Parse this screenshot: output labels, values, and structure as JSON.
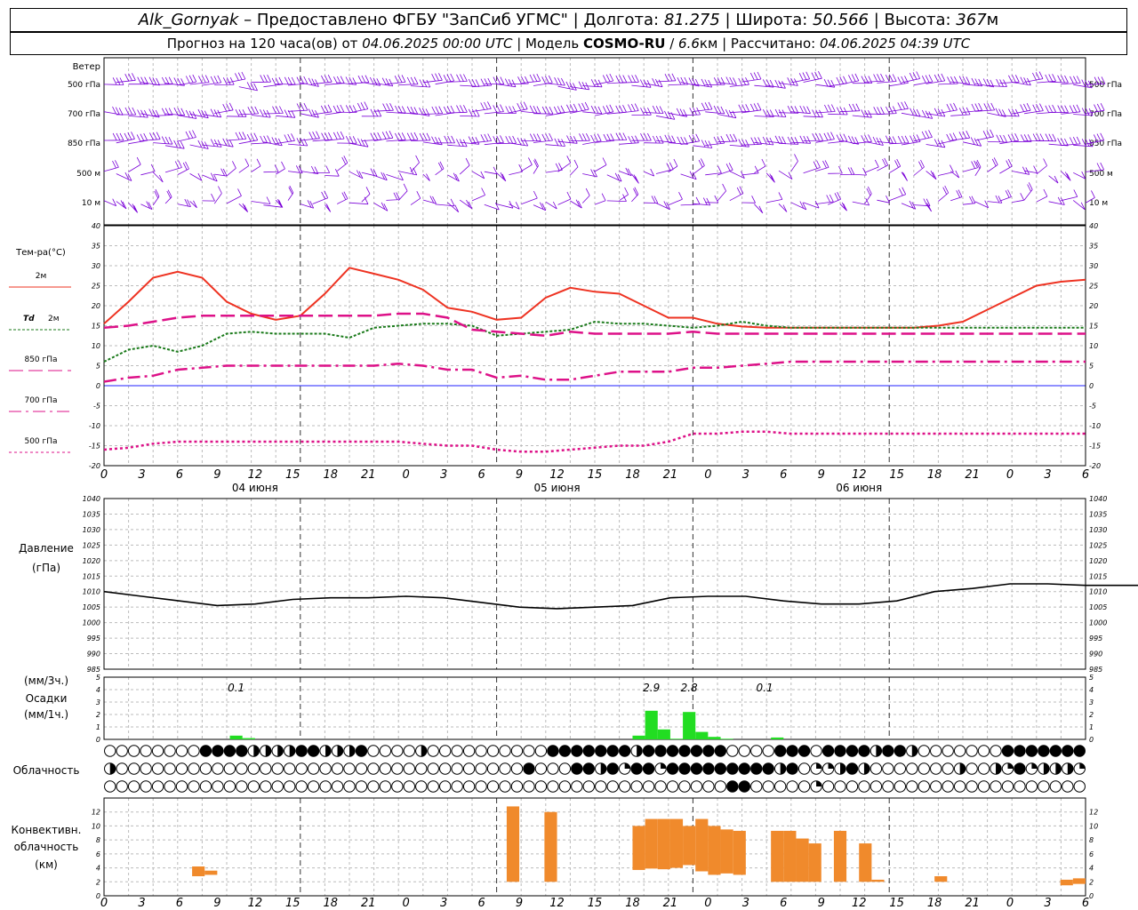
{
  "header": {
    "station": "Alk_Gornyak",
    "dash": " – ",
    "provider": "Предоставлено ФГБУ \"ЗапСиб УГМС\"",
    "sep": " | ",
    "lon_label": "Долгота: ",
    "lon": "81.275",
    "lat_label": "Широта: ",
    "lat": "50.566",
    "alt_label": "Высота: ",
    "alt": "367",
    "alt_unit": "м"
  },
  "subheader": {
    "forecast": "Прогноз на 120 часа(ов) от ",
    "start": "04.06.2025 00:00 UTC",
    "model_label": " | Модель ",
    "model": "COSMO-RU",
    "slash": " / ",
    "res": "6.6",
    "res_unit": "км",
    "calc_label": " | Рассчитано: ",
    "calc": "04.06.2025 04:39 UTC"
  },
  "colors": {
    "wind": "#7a00d8",
    "t2m": "#ee3322",
    "td": "#1a7a1a",
    "t850": "#dd1188",
    "t700": "#dd1188",
    "t500": "#dd1188",
    "zero_line": "#2222ff",
    "pressure": "#000000",
    "precip": "#22dd22",
    "convective": "#f08a2c",
    "grid": "#bbbbbb"
  },
  "wind_panel": {
    "title": "Ветер",
    "levels": [
      "500 гПа",
      "700 гПа",
      "850 гПа",
      "500 м",
      "10 м"
    ]
  },
  "x_axis": {
    "hours": [
      "0",
      "3",
      "6",
      "9",
      "12",
      "15",
      "18",
      "21",
      "0",
      "3",
      "6",
      "9",
      "12",
      "15",
      "18",
      "21",
      "0",
      "3",
      "6",
      "9",
      "12",
      "15",
      "18",
      "21",
      "0",
      "3",
      "6"
    ],
    "days": [
      "04 июня",
      "05 июня",
      "06 июня"
    ]
  },
  "chart_data": [
    {
      "type": "line",
      "title": "Тем-ра(°С)",
      "x_hours": [
        0,
        3,
        6,
        9,
        12,
        15,
        18,
        21,
        24,
        27,
        30,
        33,
        36,
        39,
        42,
        45,
        48,
        51,
        54,
        57,
        60,
        63,
        66,
        69,
        72,
        75,
        78,
        81,
        84,
        87,
        90,
        93,
        96,
        99,
        102,
        105,
        108,
        111,
        114,
        117,
        120
      ],
      "ylim": [
        -20,
        40
      ],
      "yticks": [
        -20,
        -15,
        -10,
        -5,
        0,
        5,
        10,
        15,
        20,
        25,
        30,
        35,
        40
      ],
      "series": [
        {
          "name": "2м",
          "values": [
            15.5,
            21,
            27,
            28.5,
            27,
            21,
            18,
            16.5,
            17.5,
            23,
            29.5,
            28,
            26.5,
            24,
            19.5,
            18.5,
            16.5,
            17,
            22,
            24.5,
            23.5,
            23,
            20,
            17,
            17,
            15.5,
            14.8,
            14.5,
            14.5,
            14.5,
            14.5,
            14.5,
            14.5,
            14.5,
            15,
            16,
            19,
            22,
            25,
            26,
            26.5
          ]
        },
        {
          "name": "Td 2м",
          "values": [
            6,
            9,
            10,
            8.5,
            10,
            13,
            13.5,
            13,
            13,
            13,
            12,
            14.5,
            15,
            15.5,
            15.5,
            15,
            12.5,
            13,
            13.5,
            14,
            16,
            15.5,
            15.5,
            15,
            14.5,
            15,
            16,
            15,
            14.5,
            14.5,
            14.5,
            14.5,
            14.5,
            14.5,
            14.5,
            14.5,
            14.5,
            14.5,
            14.5,
            14.5,
            14.5
          ]
        },
        {
          "name": "850 гПа",
          "values": [
            14.5,
            15,
            16,
            17,
            17.5,
            17.5,
            17.5,
            17.5,
            17.5,
            17.5,
            17.5,
            17.5,
            18,
            18,
            17,
            14,
            13.5,
            13,
            12.5,
            13.5,
            13,
            13,
            13,
            13,
            13.5,
            13,
            13,
            13,
            13,
            13,
            13,
            13,
            13,
            13,
            13,
            13,
            13,
            13,
            13,
            13,
            13
          ]
        },
        {
          "name": "700 гПа",
          "values": [
            1,
            2,
            2.5,
            4,
            4.5,
            5,
            5,
            5,
            5,
            5,
            5,
            5,
            5.5,
            5,
            4,
            4,
            2,
            2.5,
            1.5,
            1.5,
            2.5,
            3.5,
            3.5,
            3.5,
            4.5,
            4.5,
            5,
            5.5,
            6,
            6,
            6,
            6,
            6,
            6,
            6,
            6,
            6,
            6,
            6,
            6,
            6
          ]
        },
        {
          "name": "500 гПа",
          "values": [
            -16,
            -15.5,
            -14.5,
            -14,
            -14,
            -14,
            -14,
            -14,
            -14,
            -14,
            -14,
            -14,
            -14,
            -14.5,
            -15,
            -15,
            -16,
            -16.5,
            -16.5,
            -16,
            -15.5,
            -15,
            -15,
            -14,
            -12,
            -12,
            -11.5,
            -11.5,
            -12,
            -12,
            -12,
            -12,
            -12,
            -12,
            -12,
            -12,
            -12,
            -12,
            -12,
            -12,
            -12
          ]
        }
      ]
    },
    {
      "type": "line",
      "title": "Давление",
      "ylabel": "(гПа)",
      "ylim": [
        985,
        1040
      ],
      "yticks": [
        985,
        990,
        995,
        1000,
        1005,
        1010,
        1015,
        1020,
        1025,
        1030,
        1035,
        1040
      ],
      "x_hours": [
        0,
        3,
        6,
        9,
        12,
        15,
        18,
        21,
        24,
        27,
        30,
        33,
        36,
        39,
        42,
        45,
        48,
        51,
        54,
        57,
        60,
        63,
        66,
        69,
        72,
        75,
        78,
        81,
        84,
        87,
        90,
        93,
        96,
        99,
        102,
        105,
        108,
        111,
        114,
        117,
        120
      ],
      "values": [
        1010,
        1008.5,
        1007,
        1005.5,
        1006,
        1007.5,
        1008,
        1008,
        1008.5,
        1008,
        1006.5,
        1005,
        1004.5,
        1005,
        1005.5,
        1008,
        1008.5,
        1008.5,
        1007,
        1006,
        1006,
        1007,
        1010,
        1011,
        1012.5,
        1012.5,
        1012,
        1012,
        1012,
        1012,
        1012,
        1012,
        1012,
        1012,
        1012,
        1012,
        1012,
        1012,
        1012,
        1012,
        1012
      ]
    },
    {
      "type": "bar",
      "title": "Осадки",
      "ylabel_3h": "(мм/3ч.)",
      "ylabel_1h": "(мм/1ч.)",
      "ylim": [
        0,
        5
      ],
      "yticks": [
        0,
        1,
        2,
        3,
        4,
        5
      ],
      "x_hours": [
        10,
        11,
        42,
        43,
        44,
        45,
        46,
        47,
        48,
        49,
        53
      ],
      "values": [
        0.3,
        0.1,
        0.3,
        2.3,
        0.8,
        0.05,
        2.2,
        0.6,
        0.2,
        0.05,
        0.15
      ],
      "labels": [
        {
          "hour": 10.5,
          "text": "0.1"
        },
        {
          "hour": 43.5,
          "text": "2.9"
        },
        {
          "hour": 46.5,
          "text": "2.8"
        },
        {
          "hour": 52.5,
          "text": "0.1"
        }
      ]
    },
    {
      "type": "bar",
      "title": "Конвективн. облачность",
      "ylabel": "(км)",
      "ylim": [
        0,
        13
      ],
      "yticks": [
        0,
        2,
        4,
        6,
        8,
        10,
        12
      ],
      "bars": [
        {
          "hour": 7,
          "bottom": 2.8,
          "top": 4.2
        },
        {
          "hour": 8,
          "bottom": 3.0,
          "top": 3.6
        },
        {
          "hour": 32,
          "bottom": 2.0,
          "top": 12.8
        },
        {
          "hour": 35,
          "bottom": 2.0,
          "top": 12.0
        },
        {
          "hour": 42,
          "bottom": 3.7,
          "top": 10.0
        },
        {
          "hour": 43,
          "bottom": 3.9,
          "top": 11.0
        },
        {
          "hour": 44,
          "bottom": 3.8,
          "top": 11.0
        },
        {
          "hour": 45,
          "bottom": 4.0,
          "top": 11.0
        },
        {
          "hour": 46,
          "bottom": 4.4,
          "top": 10.0
        },
        {
          "hour": 47,
          "bottom": 3.5,
          "top": 11.0
        },
        {
          "hour": 48,
          "bottom": 3.0,
          "top": 10.0
        },
        {
          "hour": 49,
          "bottom": 3.2,
          "top": 9.5
        },
        {
          "hour": 50,
          "bottom": 3.0,
          "top": 9.3
        },
        {
          "hour": 53,
          "bottom": 2.0,
          "top": 9.3
        },
        {
          "hour": 54,
          "bottom": 2.0,
          "top": 9.3
        },
        {
          "hour": 55,
          "bottom": 2.0,
          "top": 8.2
        },
        {
          "hour": 56,
          "bottom": 2.0,
          "top": 7.5
        },
        {
          "hour": 58,
          "bottom": 2.0,
          "top": 9.3
        },
        {
          "hour": 60,
          "bottom": 2.0,
          "top": 7.5
        },
        {
          "hour": 61,
          "bottom": 2.0,
          "top": 2.3
        },
        {
          "hour": 66,
          "bottom": 2.0,
          "top": 2.8
        },
        {
          "hour": 76,
          "bottom": 1.5,
          "top": 2.3
        },
        {
          "hour": 77,
          "bottom": 1.7,
          "top": 2.5
        }
      ]
    }
  ],
  "cloud_panel": {
    "title": "Облачность",
    "rows": [
      "oooooooo####hhhh##hhh#oooohoooooooooo#######h#######oooo###o####h##hooooooo#######oqqhqqqo",
      "hoooooooooooooooooooooooooooooooooo#ooo##h#q##q#########h#oqqh#hooooooohoohq#qhhhqooooooo",
      "oooooooooooooooooooooooooooooooooooooooooooooooooooo##oooooqooooooooooooooooooooooooooooq"
    ]
  },
  "legend": {
    "t2m": "2м",
    "td_prefix": "Td",
    "td": "2м",
    "t850": "850 гПа",
    "t700": "700 гПа",
    "t500": "500 гПа"
  }
}
